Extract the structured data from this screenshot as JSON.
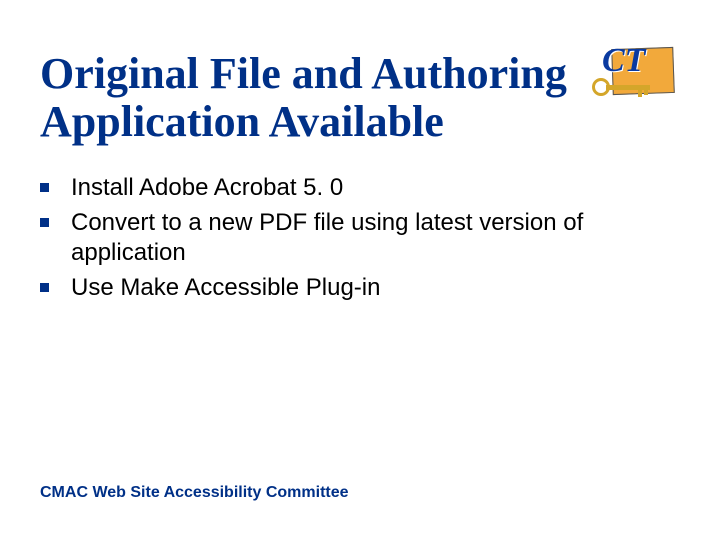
{
  "title": "Original File and Authoring Application Available",
  "bullets": [
    "Install Adobe Acrobat 5. 0",
    "Convert to a new PDF file using latest version of application",
    "Use Make Accessible Plug-in"
  ],
  "footer": "CMAC Web Site Accessibility Committee",
  "logo_text": "CT"
}
